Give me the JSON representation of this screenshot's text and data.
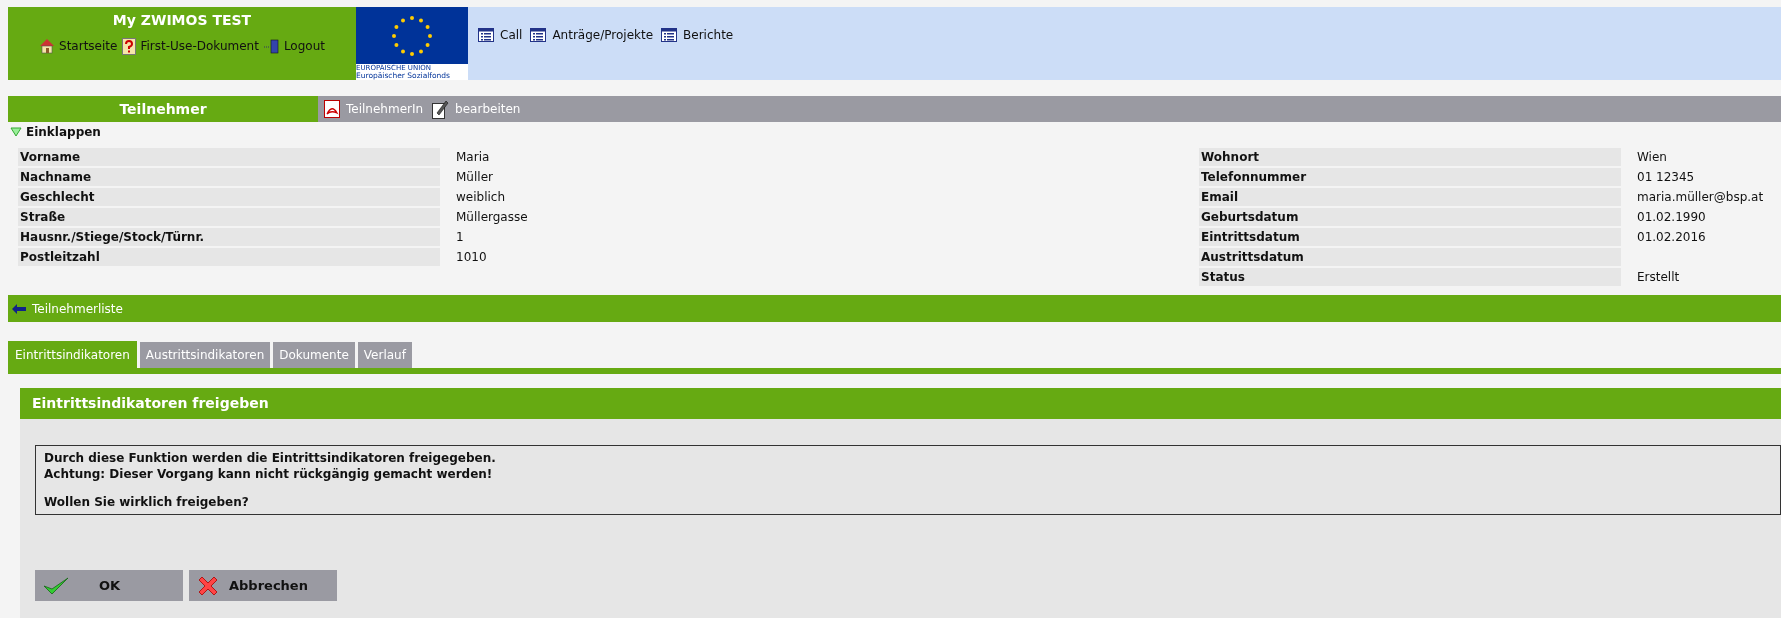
{
  "header": {
    "title": "My ZWIMOS TEST",
    "links": [
      {
        "label": "Startseite",
        "kind": "home"
      },
      {
        "label": "First-Use-Dokument",
        "kind": "help"
      },
      {
        "label": "Logout",
        "kind": "logout"
      }
    ],
    "logo": {
      "line_1": "EUROPÄISCHE UNION",
      "line_2": "Europäischer Sozialfonds"
    },
    "nav": [
      "Call",
      "Anträge/Projekte",
      "Berichte"
    ]
  },
  "section": {
    "title": "Teilnehmer",
    "actions": [
      {
        "label": "TeilnehmerIn",
        "kind": "pdf"
      },
      {
        "label": "bearbeiten",
        "kind": "edit"
      }
    ]
  },
  "collapse": {
    "label": "Einklappen",
    "expanded": true
  },
  "details_left": [
    {
      "label": "Vorname",
      "value": "Maria"
    },
    {
      "label": "Nachname",
      "value": "Müller"
    },
    {
      "label": "Geschlecht",
      "value": "weiblich"
    },
    {
      "label": "Straße",
      "value": "Müllergasse"
    },
    {
      "label": "Hausnr./Stiege/Stock/Türnr.",
      "value": "1"
    },
    {
      "label": "Postleitzahl",
      "value": "1010"
    }
  ],
  "details_right": [
    {
      "label": "Wohnort",
      "value": "Wien"
    },
    {
      "label": "Telefonnummer",
      "value": "01 12345"
    },
    {
      "label": "Email",
      "value": "maria.müller@bsp.at"
    },
    {
      "label": "Geburtsdatum",
      "value": "01.02.1990"
    },
    {
      "label": "Eintrittsdatum",
      "value": "01.02.2016"
    },
    {
      "label": "Austrittsdatum"
    },
    {
      "label": "Status",
      "value": "Erstellt"
    }
  ],
  "back_link": "Teilnehmerliste",
  "tabs": [
    {
      "label": "Eintrittsindikatoren",
      "selected": true
    },
    {
      "label": "Austrittsindikatoren",
      "selected": false
    },
    {
      "label": "Dokumente",
      "selected": false
    },
    {
      "label": "Verlauf",
      "selected": false
    }
  ],
  "dialog": {
    "title": "Eintrittsindikatoren freigeben",
    "lines": [
      "Durch diese Funktion werden die Eintrittsindikatoren freigegeben.",
      "Achtung: Dieser Vorgang kann nicht rückgängig gemacht werden!",
      "Wollen Sie wirklich freigeben?"
    ],
    "buttons": [
      {
        "label": "OK",
        "kind": "confirm"
      },
      {
        "label": "Abbrechen",
        "kind": "cancel"
      }
    ]
  }
}
